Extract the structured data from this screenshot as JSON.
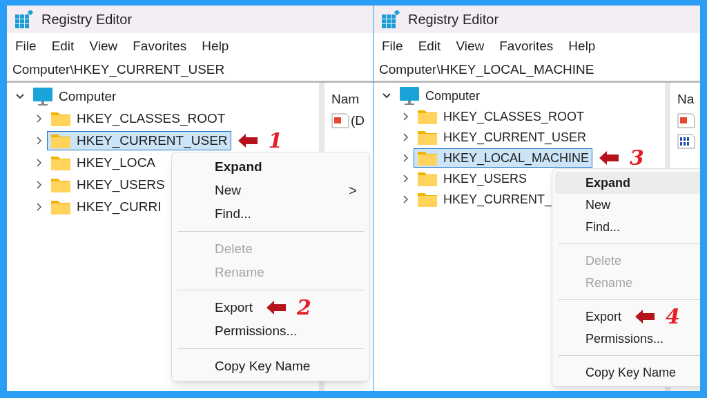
{
  "panels": [
    {
      "window": {
        "title": "Registry Editor"
      },
      "menu_bar": [
        "File",
        "Edit",
        "View",
        "Favorites",
        "Help"
      ],
      "address": "Computer\\HKEY_CURRENT_USER",
      "tree": {
        "label": "Computer",
        "expanded": true,
        "children": [
          {
            "label": "HKEY_CLASSES_ROOT",
            "expanded": false,
            "selected": false
          },
          {
            "label": "HKEY_CURRENT_USER",
            "expanded": false,
            "selected": true,
            "annotation": "1"
          },
          {
            "label": "HKEY_LOCA",
            "expanded": false,
            "selected": false
          },
          {
            "label": "HKEY_USERS",
            "expanded": false,
            "selected": false
          },
          {
            "label": "HKEY_CURRI",
            "expanded": false,
            "selected": false
          }
        ]
      },
      "values_pane": {
        "header": "Nam",
        "rows": [
          {
            "kind": "string",
            "name": "(D"
          }
        ]
      },
      "context_menu": [
        {
          "kind": "item",
          "label": "Expand",
          "default": true,
          "disabled": false,
          "highlighted": false
        },
        {
          "kind": "item",
          "label": "New",
          "default": false,
          "disabled": false,
          "highlighted": false,
          "submenu_arrow": ">"
        },
        {
          "kind": "item",
          "label": "Find...",
          "default": false,
          "disabled": false,
          "highlighted": false
        },
        {
          "kind": "separator"
        },
        {
          "kind": "item",
          "label": "Delete",
          "default": false,
          "disabled": true,
          "highlighted": false
        },
        {
          "kind": "item",
          "label": "Rename",
          "default": false,
          "disabled": true,
          "highlighted": false
        },
        {
          "kind": "separator"
        },
        {
          "kind": "item",
          "label": "Export",
          "default": false,
          "disabled": false,
          "highlighted": false,
          "annotation": "2"
        },
        {
          "kind": "item",
          "label": "Permissions...",
          "default": false,
          "disabled": false,
          "highlighted": false
        },
        {
          "kind": "separator"
        },
        {
          "kind": "item",
          "label": "Copy Key Name",
          "default": false,
          "disabled": false,
          "highlighted": false
        }
      ]
    },
    {
      "window": {
        "title": "Registry Editor"
      },
      "menu_bar": [
        "File",
        "Edit",
        "View",
        "Favorites",
        "Help"
      ],
      "address": "Computer\\HKEY_LOCAL_MACHINE",
      "tree": {
        "label": "Computer",
        "expanded": true,
        "children": [
          {
            "label": "HKEY_CLASSES_ROOT",
            "expanded": false,
            "selected": false
          },
          {
            "label": "HKEY_CURRENT_USER",
            "expanded": false,
            "selected": false
          },
          {
            "label": "HKEY_LOCAL_MACHINE",
            "expanded": false,
            "selected": true,
            "annotation": "3"
          },
          {
            "label": "HKEY_USERS",
            "expanded": false,
            "selected": false
          },
          {
            "label": "HKEY_CURRENT_",
            "expanded": false,
            "selected": false
          }
        ]
      },
      "values_pane": {
        "header": "Na",
        "rows": [
          {
            "kind": "string"
          },
          {
            "kind": "binary"
          }
        ]
      },
      "context_menu": [
        {
          "kind": "item",
          "label": "Expand",
          "default": true,
          "disabled": false,
          "highlighted": true
        },
        {
          "kind": "item",
          "label": "New",
          "default": false,
          "disabled": false,
          "highlighted": false
        },
        {
          "kind": "item",
          "label": "Find...",
          "default": false,
          "disabled": false,
          "highlighted": false
        },
        {
          "kind": "separator"
        },
        {
          "kind": "item",
          "label": "Delete",
          "default": false,
          "disabled": true,
          "highlighted": false
        },
        {
          "kind": "item",
          "label": "Rename",
          "default": false,
          "disabled": true,
          "highlighted": false
        },
        {
          "kind": "separator"
        },
        {
          "kind": "item",
          "label": "Export",
          "default": false,
          "disabled": false,
          "highlighted": false,
          "annotation": "4"
        },
        {
          "kind": "item",
          "label": "Permissions...",
          "default": false,
          "disabled": false,
          "highlighted": false
        },
        {
          "kind": "separator"
        },
        {
          "kind": "item",
          "label": "Copy Key Name",
          "default": false,
          "disabled": false,
          "highlighted": false
        }
      ]
    }
  ]
}
